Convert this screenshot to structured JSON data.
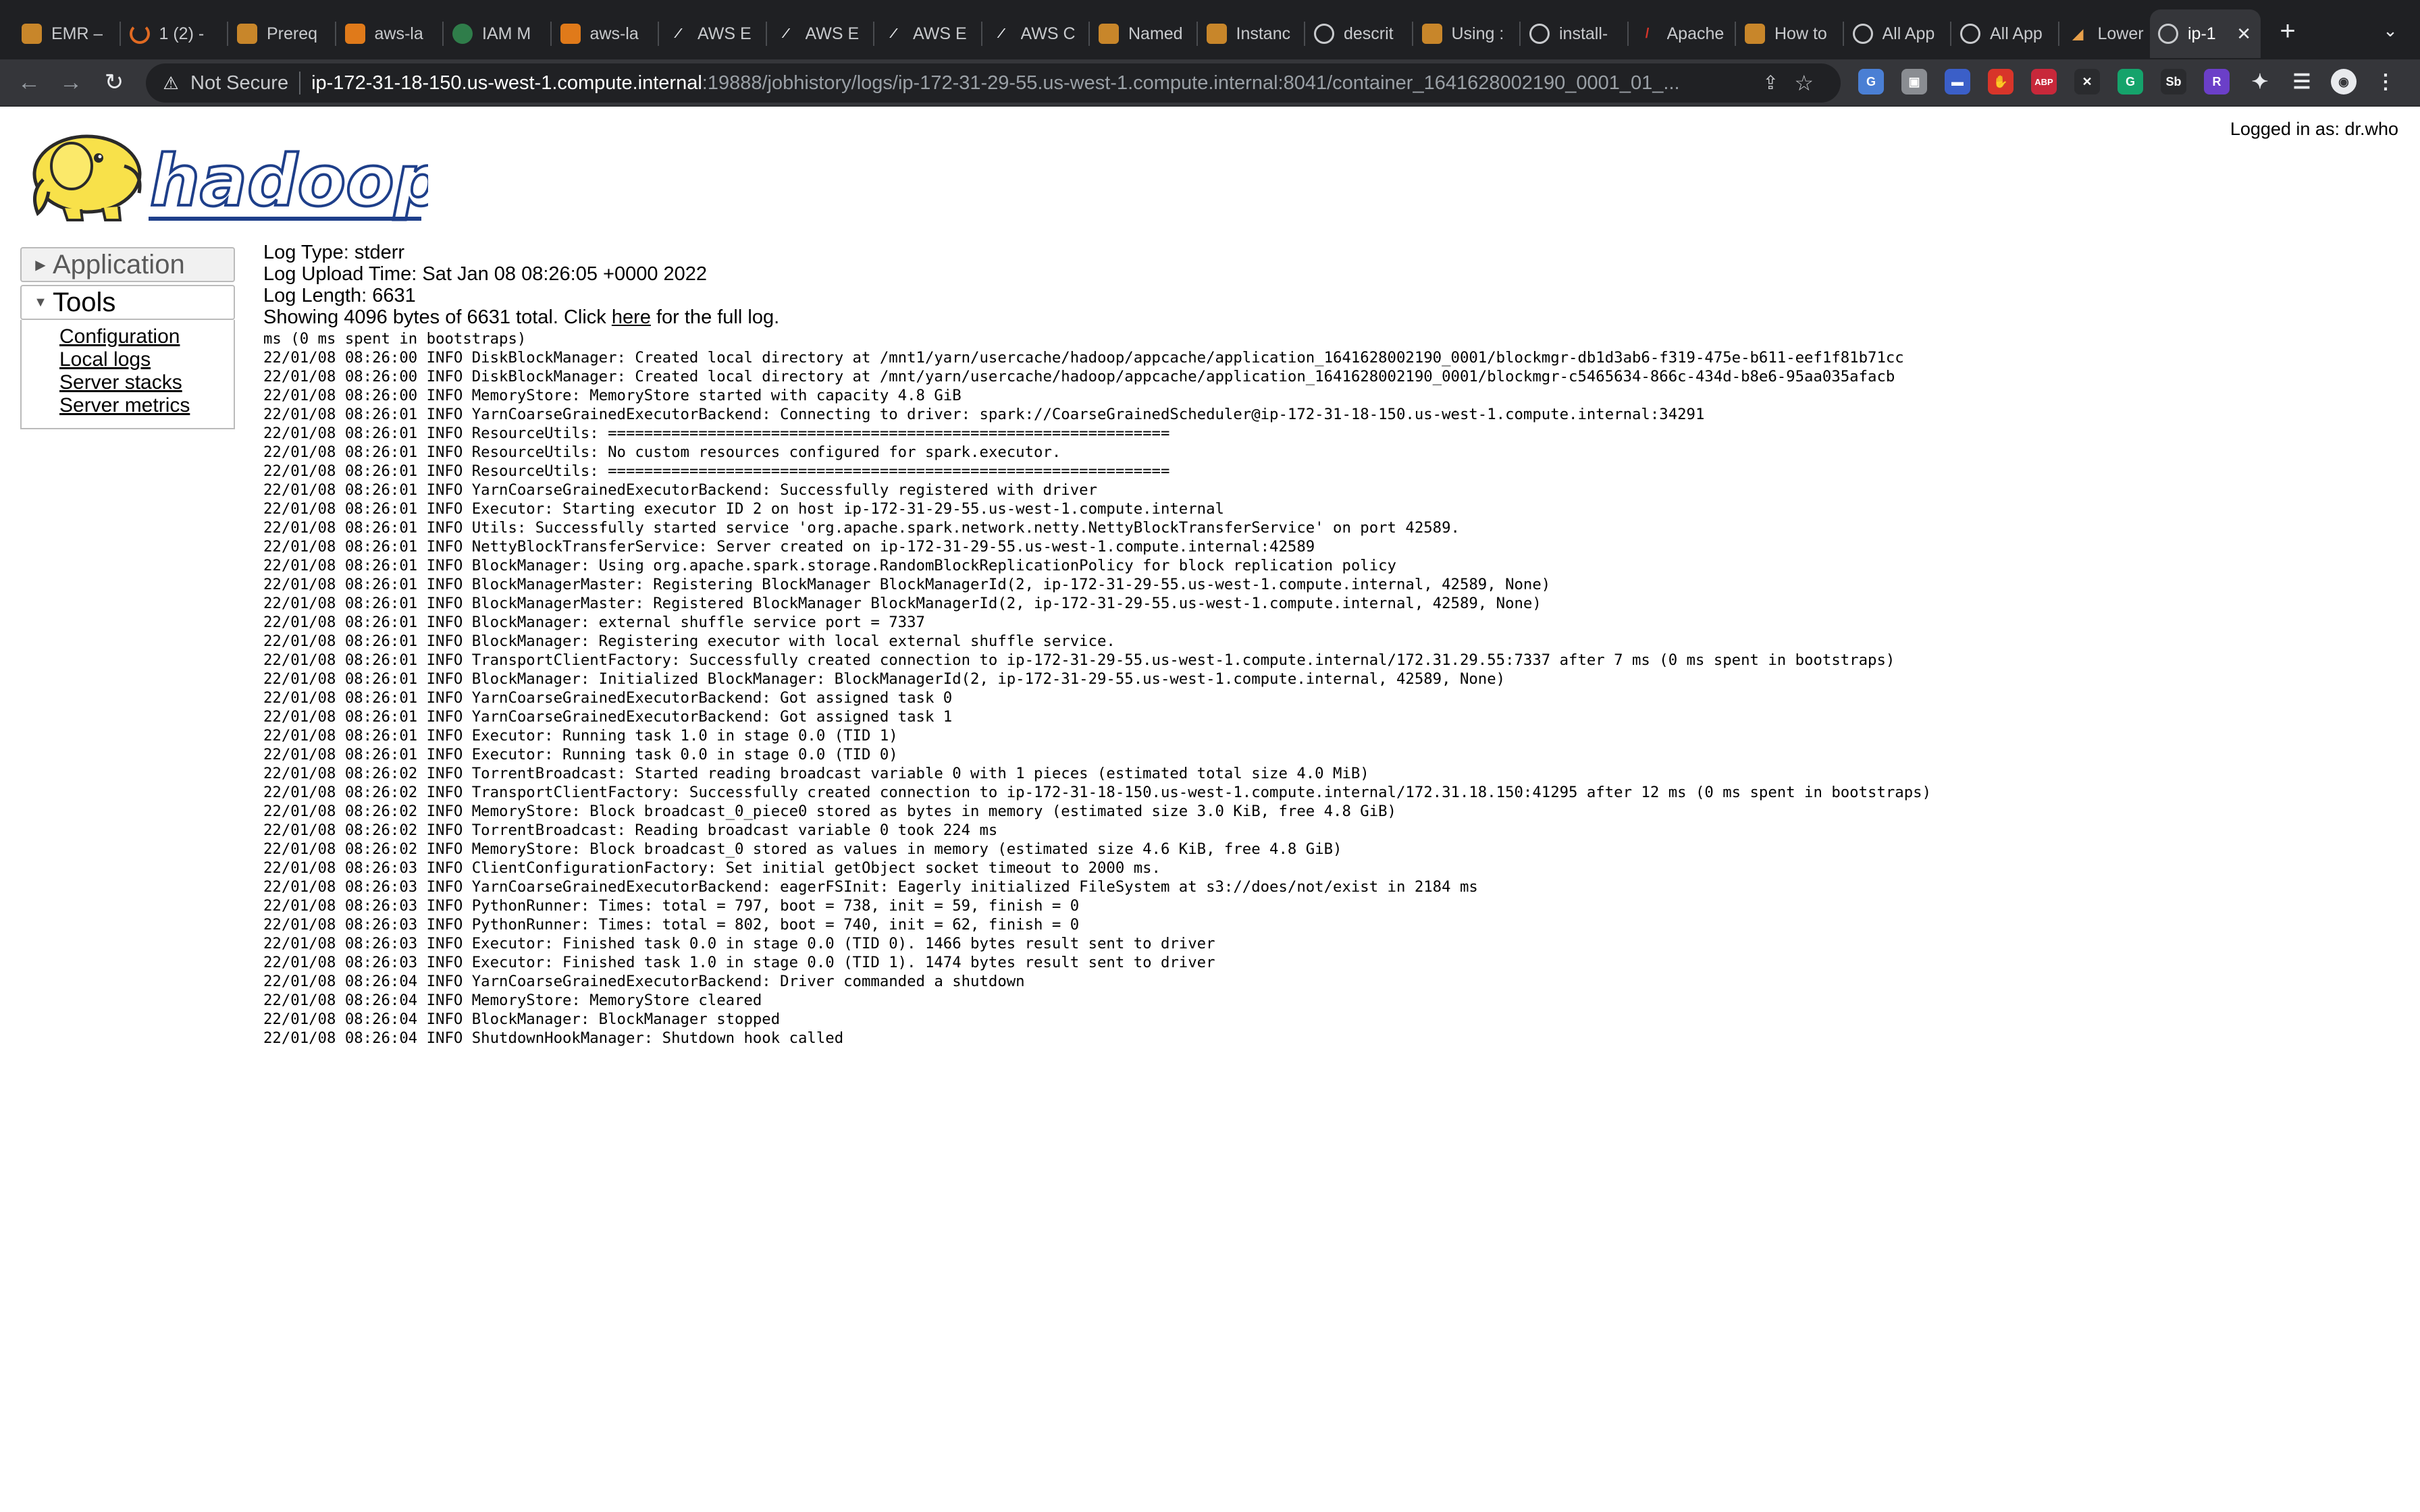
{
  "browser": {
    "tabs": [
      {
        "title": "EMR –",
        "icon": "box-icon"
      },
      {
        "title": "1 (2) -",
        "icon": "spinner-icon"
      },
      {
        "title": "Prereq",
        "icon": "box-icon"
      },
      {
        "title": "aws-la",
        "icon": "aws-cube-icon"
      },
      {
        "title": "IAM M",
        "icon": "tea-icon"
      },
      {
        "title": "aws-la",
        "icon": "aws-cube-icon"
      },
      {
        "title": "AWS E",
        "icon": "aws-icon"
      },
      {
        "title": "AWS E",
        "icon": "aws-icon"
      },
      {
        "title": "AWS E",
        "icon": "aws-icon"
      },
      {
        "title": "AWS C",
        "icon": "aws-icon"
      },
      {
        "title": "Named",
        "icon": "box-icon"
      },
      {
        "title": "Instanc",
        "icon": "box-icon"
      },
      {
        "title": "descrit",
        "icon": "globe-icon"
      },
      {
        "title": "Using :",
        "icon": "box-icon"
      },
      {
        "title": "install-",
        "icon": "globe-icon"
      },
      {
        "title": "Apache",
        "icon": "feather-icon"
      },
      {
        "title": "How to",
        "icon": "box-icon"
      },
      {
        "title": "All App",
        "icon": "globe-icon"
      },
      {
        "title": "All App",
        "icon": "globe-icon"
      },
      {
        "title": "Lower",
        "icon": "chart-icon"
      }
    ],
    "active_tab": {
      "title": "ip-1",
      "icon": "globe-icon",
      "close": "✕"
    },
    "new_tab": "+",
    "security_label": "Not Secure",
    "url_host": "ip-172-31-18-150.us-west-1.compute.internal",
    "url_rest": ":19888/jobhistory/logs/ip-172-31-29-55.us-west-1.compute.internal:8041/container_1641628002190_0001_01_...",
    "extensions": [
      {
        "name": "translate-extension-icon",
        "label": "G",
        "color": "#4a7fd4"
      },
      {
        "name": "screenshot-extension-icon",
        "label": "▣",
        "color": "#8a8d92"
      },
      {
        "name": "calendar-extension-icon",
        "label": "▬",
        "color": "#3b5fc8"
      },
      {
        "name": "stop-extension-icon",
        "label": "✋",
        "color": "#d8352a"
      },
      {
        "name": "adblock-extension-icon",
        "label": "ABP",
        "color": "#c8283a"
      },
      {
        "name": "x-extension-icon",
        "label": "✕",
        "color": "#2a2b2e"
      },
      {
        "name": "grammarly-extension-icon",
        "label": "G",
        "color": "#15a36b"
      },
      {
        "name": "sb-extension-icon",
        "label": "Sb",
        "color": "#2a2b2e"
      },
      {
        "name": "r-extension-icon",
        "label": "R",
        "color": "#6b3fc8"
      },
      {
        "name": "puzzle-extension-icon",
        "label": "✦",
        "color": "#35363a"
      },
      {
        "name": "reading-list-icon",
        "label": "☰",
        "color": "#35363a"
      },
      {
        "name": "profile-avatar",
        "label": "◉",
        "color": "#e8eaed"
      },
      {
        "name": "menu-kebab-icon",
        "label": "⋮",
        "color": "#35363a"
      }
    ]
  },
  "page": {
    "logged_in": "Logged in as: dr.who",
    "logo_text": "hadoop",
    "nav": {
      "application": "Application",
      "tools": "Tools",
      "tool_links": [
        "Configuration",
        "Local logs",
        "Server stacks",
        "Server metrics"
      ]
    },
    "log": {
      "type": "Log Type: stderr",
      "upload_time": "Log Upload Time: Sat Jan 08 08:26:05 +0000 2022",
      "length": "Log Length: 6631",
      "showing_prefix": "Showing 4096 bytes of 6631 total. Click ",
      "here": "here",
      "showing_suffix": " for the full log.",
      "lines": [
        "ms (0 ms spent in bootstraps)",
        "22/01/08 08:26:00 INFO DiskBlockManager: Created local directory at /mnt1/yarn/usercache/hadoop/appcache/application_1641628002190_0001/blockmgr-db1d3ab6-f319-475e-b611-eef1f81b71cc",
        "22/01/08 08:26:00 INFO DiskBlockManager: Created local directory at /mnt/yarn/usercache/hadoop/appcache/application_1641628002190_0001/blockmgr-c5465634-866c-434d-b8e6-95aa035afacb",
        "22/01/08 08:26:00 INFO MemoryStore: MemoryStore started with capacity 4.8 GiB",
        "22/01/08 08:26:01 INFO YarnCoarseGrainedExecutorBackend: Connecting to driver: spark://CoarseGrainedScheduler@ip-172-31-18-150.us-west-1.compute.internal:34291",
        "22/01/08 08:26:01 INFO ResourceUtils: ==============================================================",
        "22/01/08 08:26:01 INFO ResourceUtils: No custom resources configured for spark.executor.",
        "22/01/08 08:26:01 INFO ResourceUtils: ==============================================================",
        "22/01/08 08:26:01 INFO YarnCoarseGrainedExecutorBackend: Successfully registered with driver",
        "22/01/08 08:26:01 INFO Executor: Starting executor ID 2 on host ip-172-31-29-55.us-west-1.compute.internal",
        "22/01/08 08:26:01 INFO Utils: Successfully started service 'org.apache.spark.network.netty.NettyBlockTransferService' on port 42589.",
        "22/01/08 08:26:01 INFO NettyBlockTransferService: Server created on ip-172-31-29-55.us-west-1.compute.internal:42589",
        "22/01/08 08:26:01 INFO BlockManager: Using org.apache.spark.storage.RandomBlockReplicationPolicy for block replication policy",
        "22/01/08 08:26:01 INFO BlockManagerMaster: Registering BlockManager BlockManagerId(2, ip-172-31-29-55.us-west-1.compute.internal, 42589, None)",
        "22/01/08 08:26:01 INFO BlockManagerMaster: Registered BlockManager BlockManagerId(2, ip-172-31-29-55.us-west-1.compute.internal, 42589, None)",
        "22/01/08 08:26:01 INFO BlockManager: external shuffle service port = 7337",
        "22/01/08 08:26:01 INFO BlockManager: Registering executor with local external shuffle service.",
        "22/01/08 08:26:01 INFO TransportClientFactory: Successfully created connection to ip-172-31-29-55.us-west-1.compute.internal/172.31.29.55:7337 after 7 ms (0 ms spent in bootstraps)",
        "22/01/08 08:26:01 INFO BlockManager: Initialized BlockManager: BlockManagerId(2, ip-172-31-29-55.us-west-1.compute.internal, 42589, None)",
        "22/01/08 08:26:01 INFO YarnCoarseGrainedExecutorBackend: Got assigned task 0",
        "22/01/08 08:26:01 INFO YarnCoarseGrainedExecutorBackend: Got assigned task 1",
        "22/01/08 08:26:01 INFO Executor: Running task 1.0 in stage 0.0 (TID 1)",
        "22/01/08 08:26:01 INFO Executor: Running task 0.0 in stage 0.0 (TID 0)",
        "22/01/08 08:26:02 INFO TorrentBroadcast: Started reading broadcast variable 0 with 1 pieces (estimated total size 4.0 MiB)",
        "22/01/08 08:26:02 INFO TransportClientFactory: Successfully created connection to ip-172-31-18-150.us-west-1.compute.internal/172.31.18.150:41295 after 12 ms (0 ms spent in bootstraps)",
        "22/01/08 08:26:02 INFO MemoryStore: Block broadcast_0_piece0 stored as bytes in memory (estimated size 3.0 KiB, free 4.8 GiB)",
        "22/01/08 08:26:02 INFO TorrentBroadcast: Reading broadcast variable 0 took 224 ms",
        "22/01/08 08:26:02 INFO MemoryStore: Block broadcast_0 stored as values in memory (estimated size 4.6 KiB, free 4.8 GiB)",
        "22/01/08 08:26:03 INFO ClientConfigurationFactory: Set initial getObject socket timeout to 2000 ms.",
        "22/01/08 08:26:03 INFO YarnCoarseGrainedExecutorBackend: eagerFSInit: Eagerly initialized FileSystem at s3://does/not/exist in 2184 ms",
        "22/01/08 08:26:03 INFO PythonRunner: Times: total = 797, boot = 738, init = 59, finish = 0",
        "22/01/08 08:26:03 INFO PythonRunner: Times: total = 802, boot = 740, init = 62, finish = 0",
        "22/01/08 08:26:03 INFO Executor: Finished task 0.0 in stage 0.0 (TID 0). 1466 bytes result sent to driver",
        "22/01/08 08:26:03 INFO Executor: Finished task 1.0 in stage 0.0 (TID 1). 1474 bytes result sent to driver",
        "22/01/08 08:26:04 INFO YarnCoarseGrainedExecutorBackend: Driver commanded a shutdown",
        "22/01/08 08:26:04 INFO MemoryStore: MemoryStore cleared",
        "22/01/08 08:26:04 INFO BlockManager: BlockManager stopped",
        "22/01/08 08:26:04 INFO ShutdownHookManager: Shutdown hook called"
      ]
    }
  }
}
